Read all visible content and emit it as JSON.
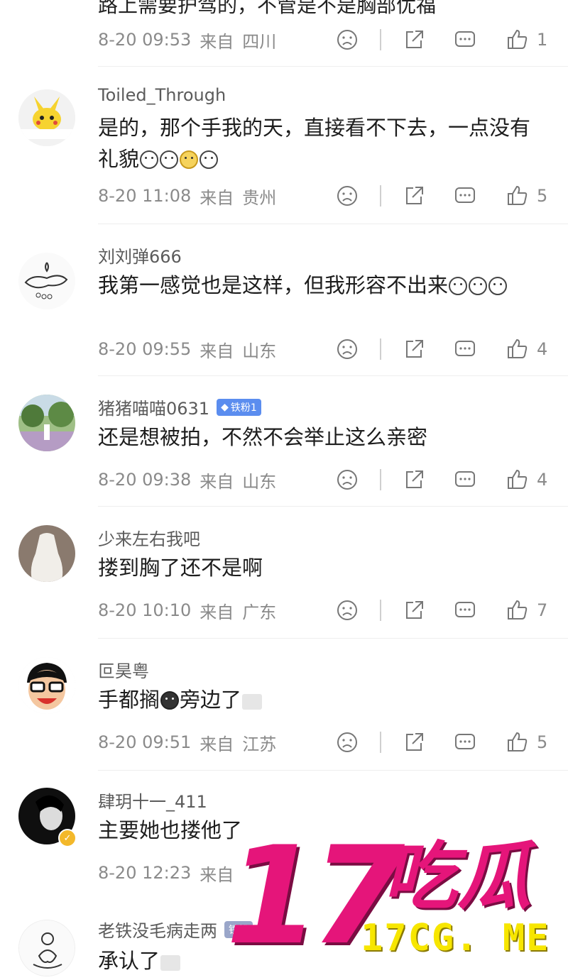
{
  "colors": {
    "meta_gray": "#8a8a8a",
    "username_gray": "#5b5b5b",
    "badge_blue": "#5b8def",
    "watermark_pink": "#e5157a",
    "watermark_yellow": "#f7e600"
  },
  "icons": {
    "dislike": "frown-face-icon",
    "share": "share-arrow-icon",
    "comment": "comment-bubble-icon",
    "like": "thumbs-up-icon"
  },
  "top_partial": {
    "text_cut": "路上需要护驾的，不管是不是胸部优福",
    "time": "8-20 09:53",
    "from": "来自",
    "location": "四川",
    "likes": "1"
  },
  "comments": [
    {
      "username": "Toiled_Through",
      "text": "是的，那个手我的天，直接看不下去，一点没有礼貌",
      "time": "8-20 11:08",
      "from": "来自",
      "location": "贵州",
      "likes": "5"
    },
    {
      "username": "刘刘弹666",
      "text": "我第一感觉也是这样，但我形容不出来",
      "time": "8-20 09:55",
      "from": "来自",
      "location": "山东",
      "likes": "4"
    },
    {
      "username": "猪猪喵喵0631",
      "badge": "铁粉1",
      "text": "还是想被拍，不然不会举止这么亲密",
      "time": "8-20 09:38",
      "from": "来自",
      "location": "山东",
      "likes": "4"
    },
    {
      "username": "少来左右我吧",
      "text": "搂到胸了还不是啊",
      "time": "8-20 10:10",
      "from": "来自",
      "location": "广东",
      "likes": "7"
    },
    {
      "username": "叵昊粤",
      "text_before": "手都搁",
      "text_after": "旁边了",
      "time": "8-20 09:51",
      "from": "来自",
      "location": "江苏",
      "likes": "5"
    },
    {
      "username": "肆玥十一_411",
      "text": "主要她也搂他了",
      "time": "8-20 12:23",
      "from": "来自"
    },
    {
      "username": "老铁没毛病走两",
      "badge": "铁粉",
      "text": "承认了"
    }
  ],
  "watermark": {
    "number": "17",
    "chinese": "吃瓜",
    "url": "17CG. ME"
  }
}
